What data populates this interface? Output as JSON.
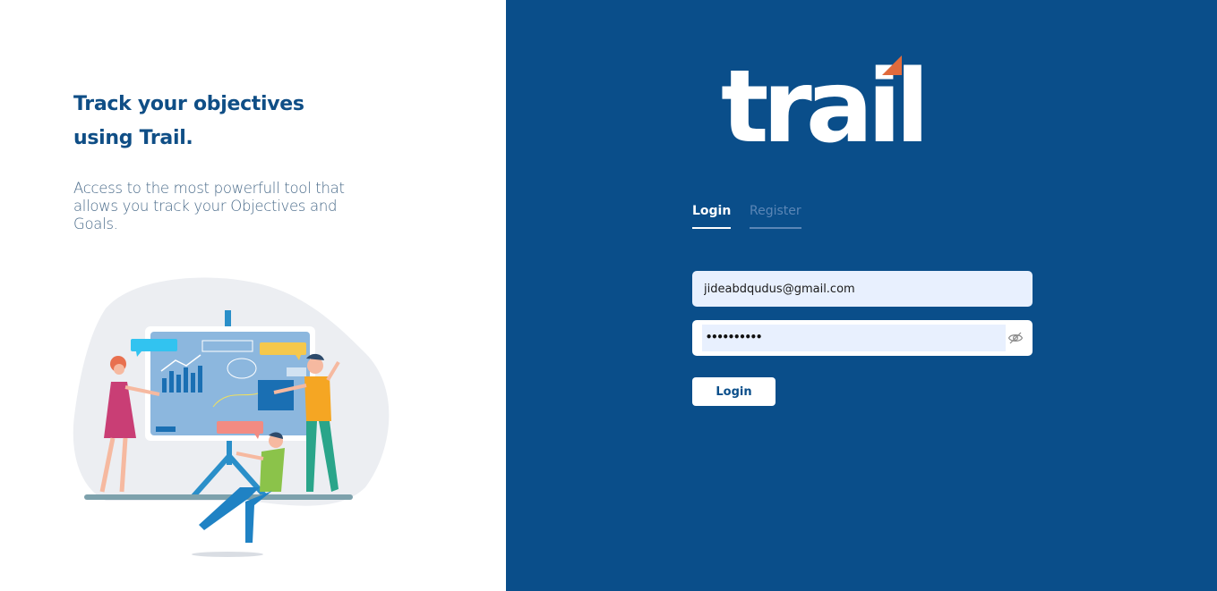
{
  "hero": {
    "headline": "Track your objectives using Trail.",
    "description": "Access to the most powerfull tool that allows you track your Objectives and Goals."
  },
  "brand": {
    "logo_text": "trail",
    "accent_color": "#e06a3c",
    "primary_color": "#0a4e8a"
  },
  "auth_tabs": [
    {
      "label": "Login",
      "active": true
    },
    {
      "label": "Register",
      "active": false
    }
  ],
  "form": {
    "email_value": "jideabdqudus@gmail.com",
    "password_masked": "••••••••••",
    "submit_label": "Login"
  },
  "icons": {
    "password_toggle": "eye-slash-icon"
  }
}
